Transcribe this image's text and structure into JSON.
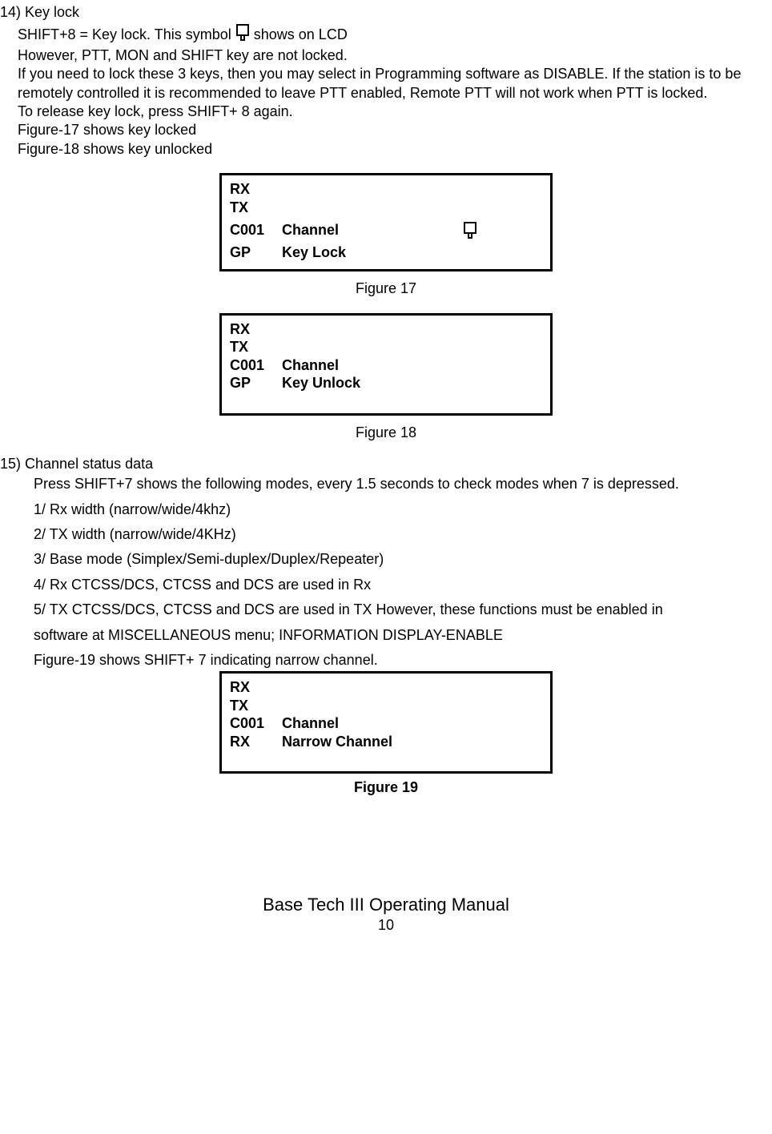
{
  "section14": {
    "heading": "14) Key lock",
    "line1_a": "SHIFT+8 = Key lock. This symbol",
    "line1_b": "shows on LCD",
    "line2": "However, PTT, MON and SHIFT key are not locked.",
    "line3": "If you need to lock these 3 keys, then you may select in Programming software as DISABLE. If the station is to be remotely controlled it is recommended to leave PTT enabled, Remote PTT will not work when PTT is locked.",
    "line4": "To release key lock, press SHIFT+ 8 again.",
    "line5": "Figure-17 shows key locked",
    "line6": "Figure-18 shows key unlocked"
  },
  "lcd17": {
    "rx": "RX",
    "tx": "TX",
    "row1a": "C001",
    "row1b": "Channel",
    "row2a": "GP",
    "row2b": "Key  Lock"
  },
  "caption17": "Figure 17",
  "lcd18": {
    "rx": "RX",
    "tx": "TX",
    "row1a": "C001",
    "row1b": "Channel",
    "row2a": "GP",
    "row2b": "Key  Unlock"
  },
  "caption18": "Figure 18",
  "section15": {
    "heading": "15) Channel status data",
    "intro": "Press SHIFT+7 shows the following modes, every 1.5 seconds to check modes when 7 is depressed.",
    "i1": "1/ Rx width (narrow/wide/4khz)",
    "i2": "2/ TX width (narrow/wide/4KHz)",
    "i3": "3/ Base mode (Simplex/Semi-duplex/Duplex/Repeater)",
    "i4": "4/ Rx CTCSS/DCS, CTCSS and DCS are used in Rx",
    "i5": "5/ TX CTCSS/DCS, CTCSS and DCS are used in TX However, these functions must be enabled in",
    "i6": "software at MISCELLANEOUS menu; INFORMATION DISPLAY-ENABLE",
    "i7": "Figure-19 shows SHIFT+ 7 indicating narrow channel."
  },
  "lcd19": {
    "rx": "RX",
    "tx": "TX",
    "row1a": "C001",
    "row1b": "Channel",
    "row2a": "RX",
    "row2b": "Narrow Channel"
  },
  "caption19": "Figure 19",
  "footer": "Base Tech III Operating Manual",
  "page": "10"
}
